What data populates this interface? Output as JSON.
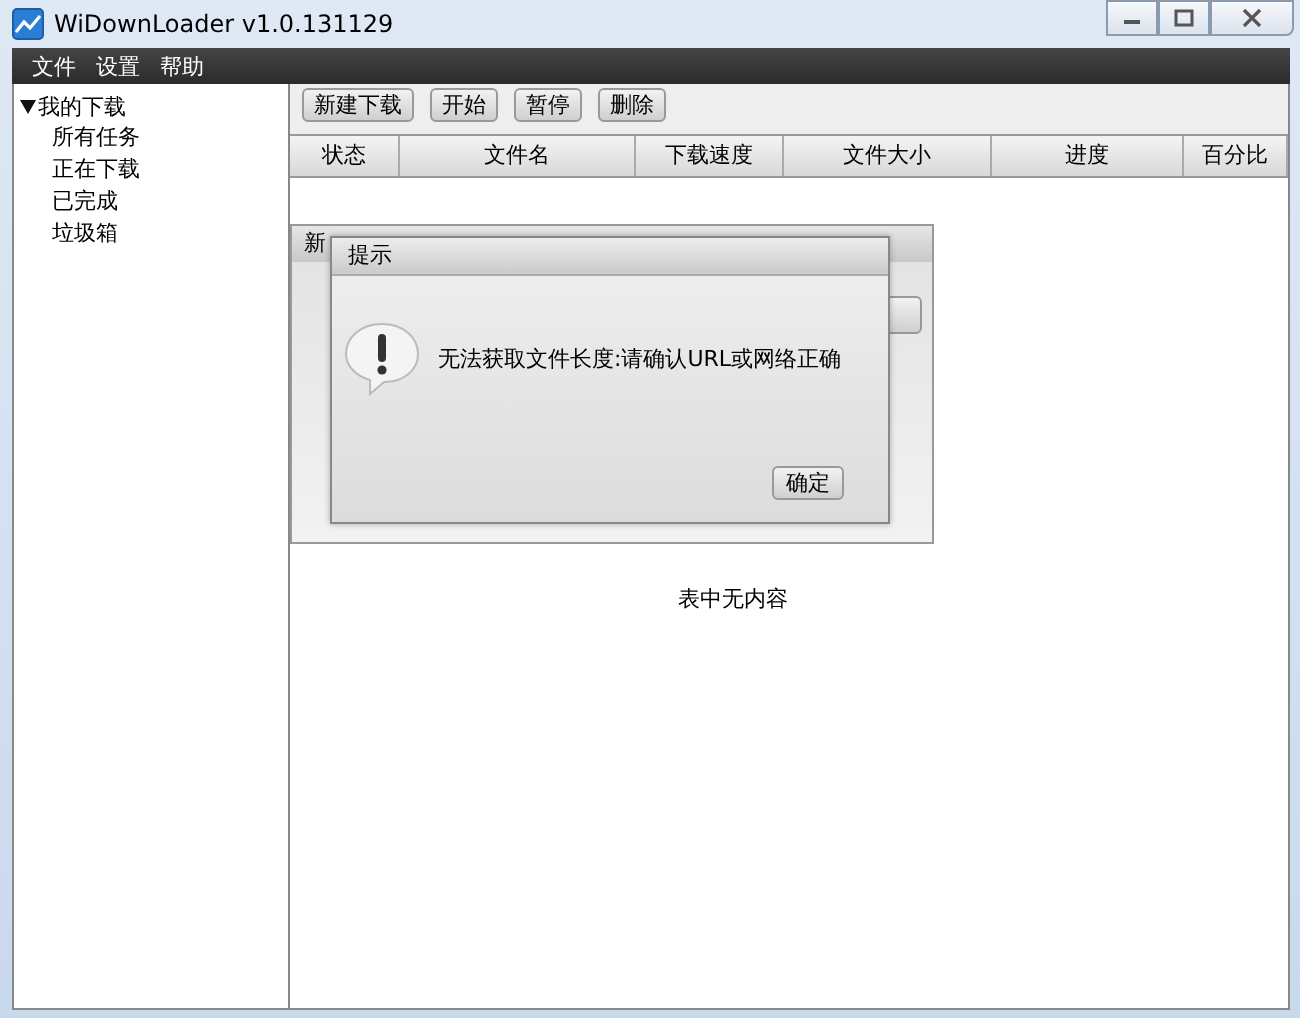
{
  "window": {
    "title": "WiDownLoader v1.0.131129"
  },
  "menu": [
    "文件",
    "设置",
    "帮助"
  ],
  "sidebar": {
    "items": [
      {
        "label": "我的下载",
        "expanded": true,
        "children": [
          {
            "label": "所有任务"
          },
          {
            "label": "正在下载"
          },
          {
            "label": "已完成"
          },
          {
            "label": "垃圾箱"
          }
        ]
      }
    ]
  },
  "toolbar": [
    "新建下载",
    "开始",
    "暂停",
    "删除"
  ],
  "table": {
    "columns": [
      "状态",
      "文件名",
      "下载速度",
      "文件大小",
      "进度",
      "百分比"
    ],
    "empty_text": "表中无内容"
  },
  "background_dialog": {
    "title": "新"
  },
  "dialog": {
    "title": "提示",
    "message": "无法获取文件长度:请确认URL或网络正确",
    "button": "确定"
  }
}
